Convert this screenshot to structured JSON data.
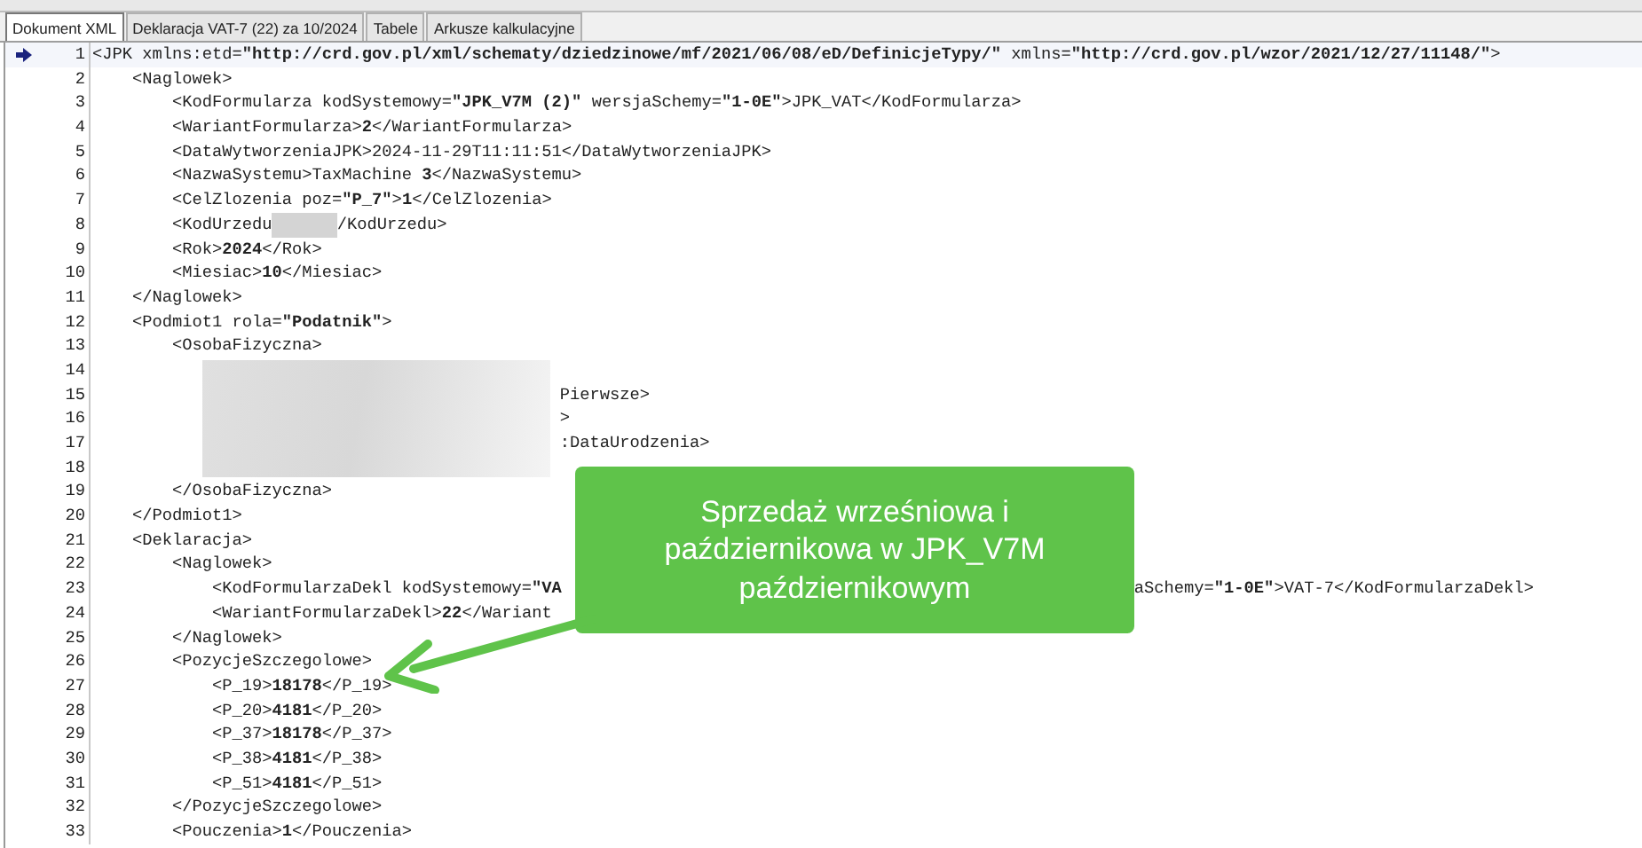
{
  "tabs": [
    {
      "label": "Dokument XML",
      "selected": true
    },
    {
      "label": "Deklaracja VAT-7 (22) za 10/2024",
      "selected": false
    },
    {
      "label": "Tabele",
      "selected": false
    },
    {
      "label": "Arkusze kalkulacyjne",
      "selected": false
    }
  ],
  "editor": {
    "lines": [
      {
        "number": "1",
        "current": true,
        "kind": "code",
        "text": "<JPK xmlns:etd=**\"http://crd.gov.pl/xml/schematy/dziedzinowe/mf/2021/06/08/eD/DefinicjeTypy/\"** xmlns=**\"http://crd.gov.pl/wzor/2021/12/27/11148/\"**>"
      },
      {
        "number": "2",
        "current": false,
        "kind": "code",
        "text": "    <Naglowek>"
      },
      {
        "number": "3",
        "current": false,
        "kind": "code",
        "text": "        <KodFormularza kodSystemowy=**\"JPK_V7M (2)\"** wersjaSchemy=**\"1-0E\"**>JPK_VAT</KodFormularza>"
      },
      {
        "number": "4",
        "current": false,
        "kind": "code",
        "text": "        <WariantFormularza>**2**</WariantFormularza>"
      },
      {
        "number": "5",
        "current": false,
        "kind": "code",
        "text": "        <DataWytworzeniaJPK>2024-11-29T11:11:51</DataWytworzeniaJPK>"
      },
      {
        "number": "6",
        "current": false,
        "kind": "code",
        "text": "        <NazwaSystemu>TaxMachine **3**</NazwaSystemu>"
      },
      {
        "number": "7",
        "current": false,
        "kind": "code",
        "text": "        <CelZlozenia poz=**\"P_7\"**>**1**</CelZlozenia>"
      },
      {
        "number": "8",
        "current": false,
        "kind": "gap",
        "text": "        <KodUrzedu",
        "tail": "/KodUrzedu>"
      },
      {
        "number": "9",
        "current": false,
        "kind": "code",
        "text": "        <Rok>**2024**</Rok>"
      },
      {
        "number": "10",
        "current": false,
        "kind": "code",
        "text": "        <Miesiac>**10**</Miesiac>"
      },
      {
        "number": "11",
        "current": false,
        "kind": "code",
        "text": "    </Naglowek>"
      },
      {
        "number": "12",
        "current": false,
        "kind": "code",
        "text": "    <Podmiot1 rola=**\"Podatnik\"**>"
      },
      {
        "number": "13",
        "current": false,
        "kind": "code",
        "text": "        <OsobaFizyczna>"
      },
      {
        "number": "14",
        "current": false,
        "kind": "code"
      },
      {
        "number": "15",
        "current": false,
        "kind": "blurred",
        "tail": "Pierwsze>"
      },
      {
        "number": "16",
        "current": false,
        "kind": "blurred",
        "tail": ">"
      },
      {
        "number": "17",
        "current": false,
        "kind": "blurred",
        "tail": ":DataUrodzenia>"
      },
      {
        "number": "18",
        "current": false,
        "kind": "code"
      },
      {
        "number": "19",
        "current": false,
        "kind": "code",
        "text": "        </OsobaFizyczna>"
      },
      {
        "number": "20",
        "current": false,
        "kind": "code",
        "text": "    </Podmiot1>"
      },
      {
        "number": "21",
        "current": false,
        "kind": "code",
        "text": "    <Deklaracja>"
      },
      {
        "number": "22",
        "current": false,
        "kind": "code",
        "text": "        <Naglowek>"
      },
      {
        "number": "23",
        "current": false,
        "kind": "covered",
        "text": "            <KodFormularzaDekl kodSystemowy=**\"VA**",
        "tail": "aSchemy=**\"1-0E\"**>VAT-7</KodFormularzaDekl>"
      },
      {
        "number": "24",
        "current": false,
        "kind": "code",
        "text": "            <WariantFormularzaDekl>**22**</Wariant"
      },
      {
        "number": "25",
        "current": false,
        "kind": "code",
        "text": "        </Naglowek>"
      },
      {
        "number": "26",
        "current": false,
        "kind": "code",
        "text": "        <PozycjeSzczegolowe>"
      },
      {
        "number": "27",
        "current": false,
        "kind": "code",
        "text": "            <P_19>**18178**</P_19>"
      },
      {
        "number": "28",
        "current": false,
        "kind": "code",
        "text": "            <P_20>**4181**</P_20>"
      },
      {
        "number": "29",
        "current": false,
        "kind": "code",
        "text": "            <P_37>**18178**</P_37>"
      },
      {
        "number": "30",
        "current": false,
        "kind": "code",
        "text": "            <P_38>**4181**</P_38>"
      },
      {
        "number": "31",
        "current": false,
        "kind": "code",
        "text": "            <P_51>**4181**</P_51>"
      },
      {
        "number": "32",
        "current": false,
        "kind": "code",
        "text": "        </PozycjeSzczegolowe>"
      },
      {
        "number": "33",
        "current": false,
        "kind": "code",
        "text": "        <Pouczenia>**1**</Pouczenia>"
      }
    ]
  },
  "callout": {
    "text": "Sprzedaż wrześniowa i październikowa w JPK_V7M październikowym"
  }
}
